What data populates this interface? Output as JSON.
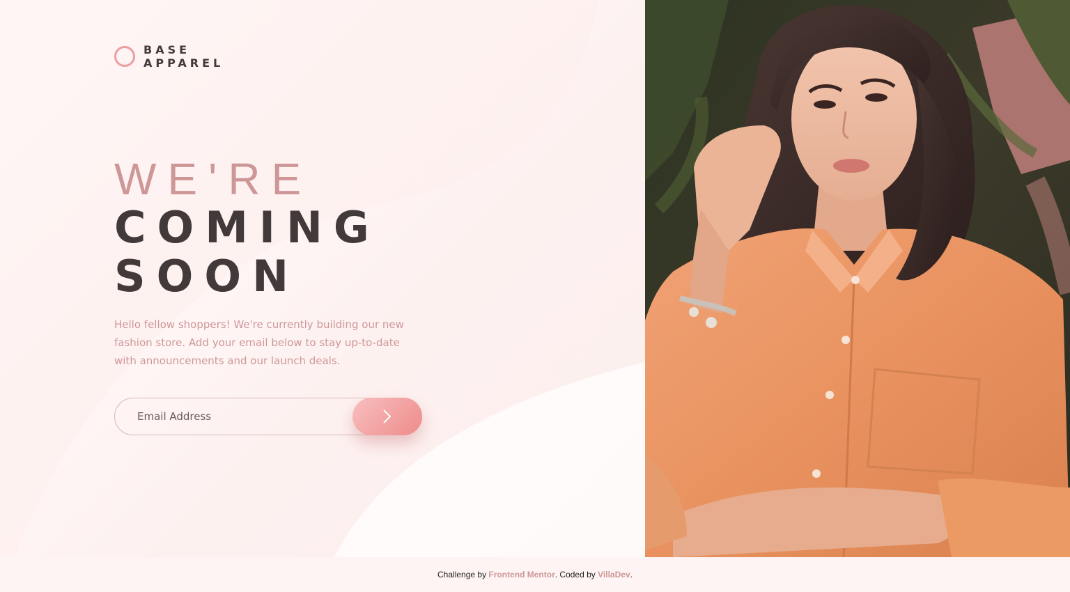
{
  "brand": {
    "line1": "BASE",
    "line2": "APPAREL"
  },
  "hero": {
    "line1": "WE'RE",
    "line2": "COMING",
    "line3": "SOON",
    "description": "Hello fellow shoppers! We're currently building our new fashion store. Add your email below to stay up-to-date with announcements and our launch deals."
  },
  "form": {
    "email_placeholder": "Email Address",
    "submit_icon": "chevron-right-icon"
  },
  "photo": {
    "subject": "woman-in-orange-shirt-photo"
  },
  "footer": {
    "prefix": "Challenge by",
    "link1": "Frontend Mentor",
    "middle": ". Coded by",
    "link2": "VillaDev",
    "suffix": "."
  },
  "colors": {
    "accent": "#ce9797",
    "dark": "#423a3a",
    "button_start": "#f8bfbf",
    "button_end": "#ee8b8b",
    "background": "#fdf4f3"
  }
}
